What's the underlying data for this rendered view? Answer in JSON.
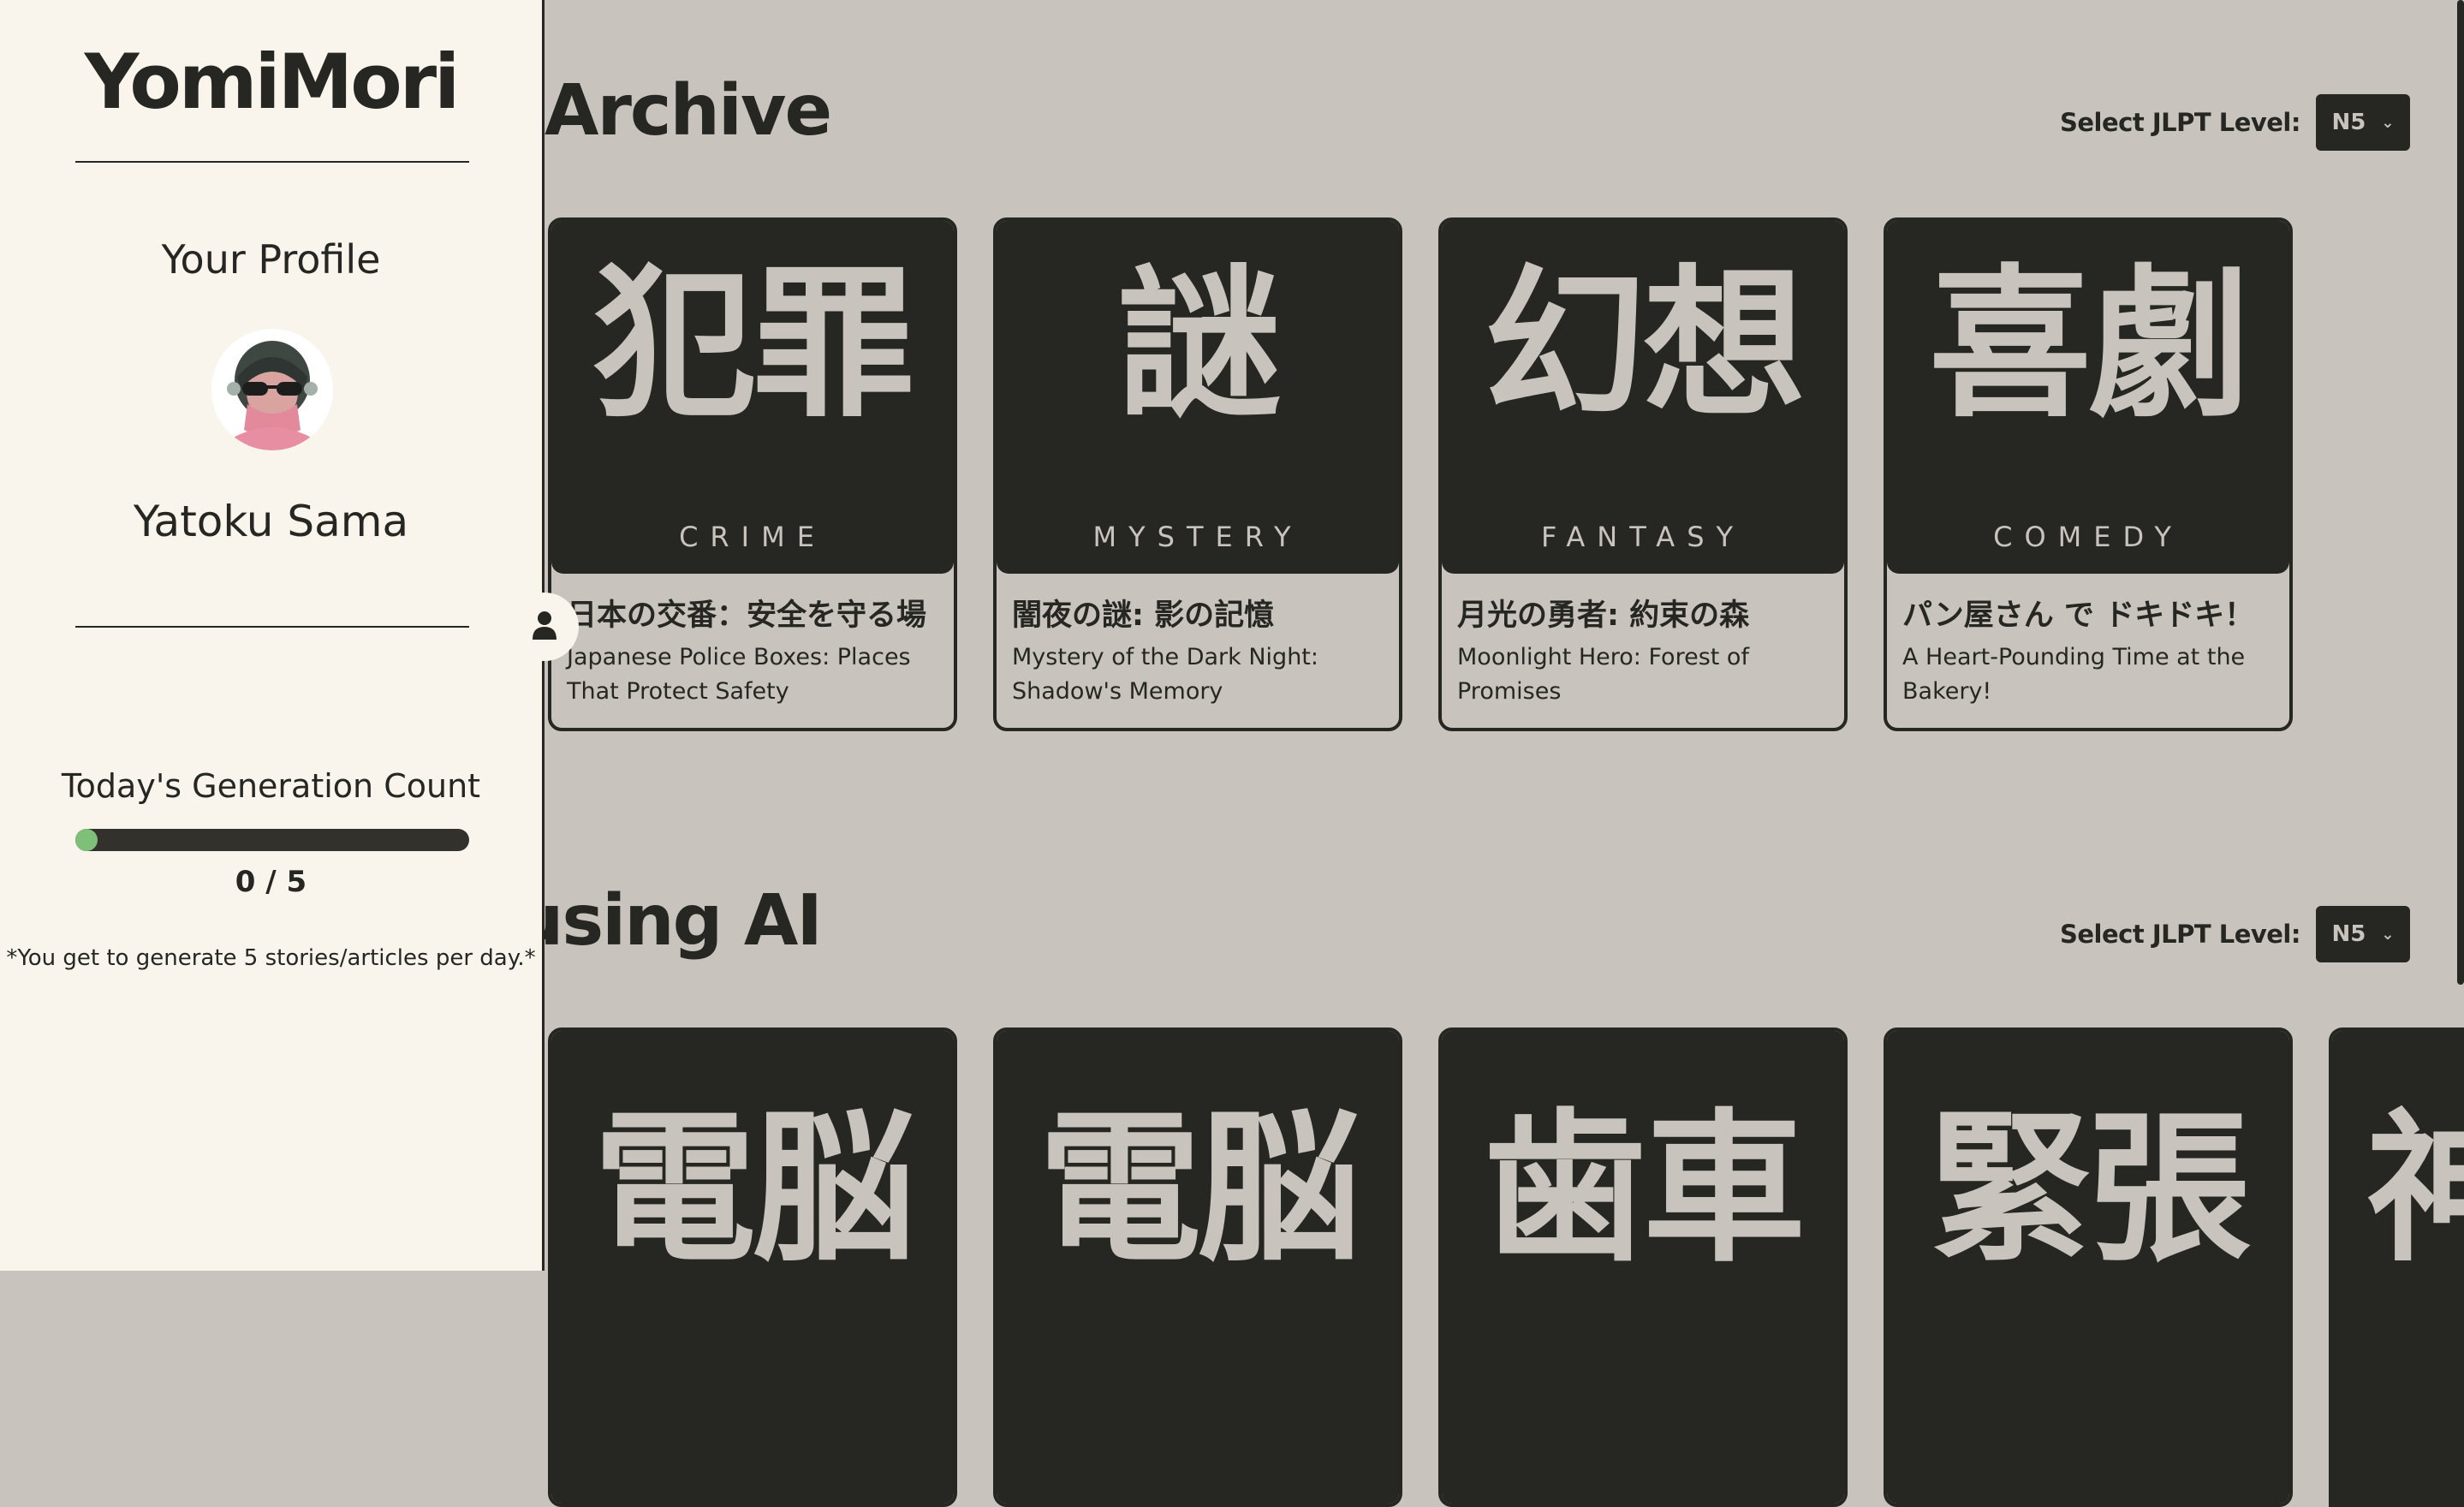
{
  "sidebar": {
    "brand": "YomiMori",
    "profile_title": "Your Profile",
    "avatar_icon": "user-avatar-icon",
    "username": "Yatoku Sama",
    "generation_title": "Today's Generation Count",
    "generation_used": 0,
    "generation_limit": 5,
    "generation_count_text": "0 / 5",
    "generation_note": "*You get to generate 5 stories/articles per day.*",
    "toggle_icon": "person-icon",
    "progress_color": "#7ec07a"
  },
  "archive": {
    "title": "Archive",
    "level_label": "Select JLPT Level:",
    "level_value": "N5",
    "cards": [
      {
        "kanji": "犯罪",
        "genre": "CRIME",
        "title_jp": "日本の交番：安全を守る場",
        "title_en": "Japanese Police Boxes: Places That Protect Safety"
      },
      {
        "kanji": "謎",
        "genre": "MYSTERY",
        "title_jp": "闇夜の謎: 影の記憶",
        "title_en": "Mystery of the Dark Night: Shadow's Memory"
      },
      {
        "kanji": "幻想",
        "genre": "FANTASY",
        "title_jp": "月光の勇者: 約束の森",
        "title_en": "Moonlight Hero: Forest of Promises"
      },
      {
        "kanji": "喜劇",
        "genre": "COMEDY",
        "title_jp": "パン屋さん で ドキドキ！",
        "title_en": "A Heart-Pounding Time at the Bakery!"
      }
    ]
  },
  "ai": {
    "title": "using AI",
    "level_label": "Select JLPT Level:",
    "level_value": "N5",
    "cards": [
      {
        "kanji": "電脳"
      },
      {
        "kanji": "電脳"
      },
      {
        "kanji": "歯車"
      },
      {
        "kanji": "緊張"
      },
      {
        "kanji": "神"
      }
    ]
  },
  "colors": {
    "background": "#c8c4bd",
    "dark": "#262622",
    "sidebar": "#faf5ec"
  }
}
